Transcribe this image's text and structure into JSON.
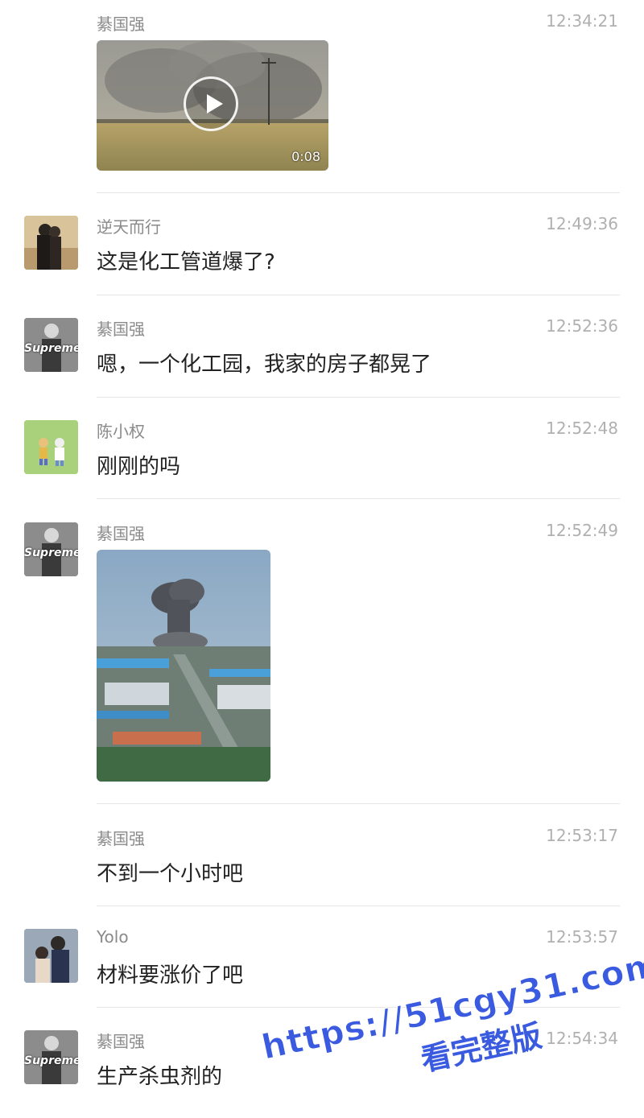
{
  "messages": [
    {
      "sender": "綦国强",
      "time": "12:34:21",
      "type": "video",
      "duration": "0:08"
    },
    {
      "sender": "逆天而行",
      "time": "12:49:36",
      "text": "这是化工管道爆了?"
    },
    {
      "sender": "綦国强",
      "time": "12:52:36",
      "text": "嗯，一个化工园，我家的房子都晃了"
    },
    {
      "sender": "陈小权",
      "time": "12:52:48",
      "text": "刚刚的吗"
    },
    {
      "sender": "綦国强",
      "time": "12:52:49",
      "type": "image"
    },
    {
      "sender": "綦国强",
      "time": "12:53:17",
      "text": "不到一个小时吧"
    },
    {
      "sender": "Yolo",
      "time": "12:53:57",
      "text": "材料要涨价了吧"
    },
    {
      "sender": "綦国强",
      "time": "12:54:34",
      "text": "生产杀虫剂的"
    }
  ],
  "avatar_text": {
    "supreme": "Supreme"
  },
  "watermark": {
    "line1": "https://51cgy31.com",
    "line2": "看完整版"
  },
  "colors": {
    "sender": "#8a8a8a",
    "time": "#b0b0b0",
    "text": "#222222",
    "divider": "#e6e6e6",
    "watermark": "#3a5be0"
  }
}
